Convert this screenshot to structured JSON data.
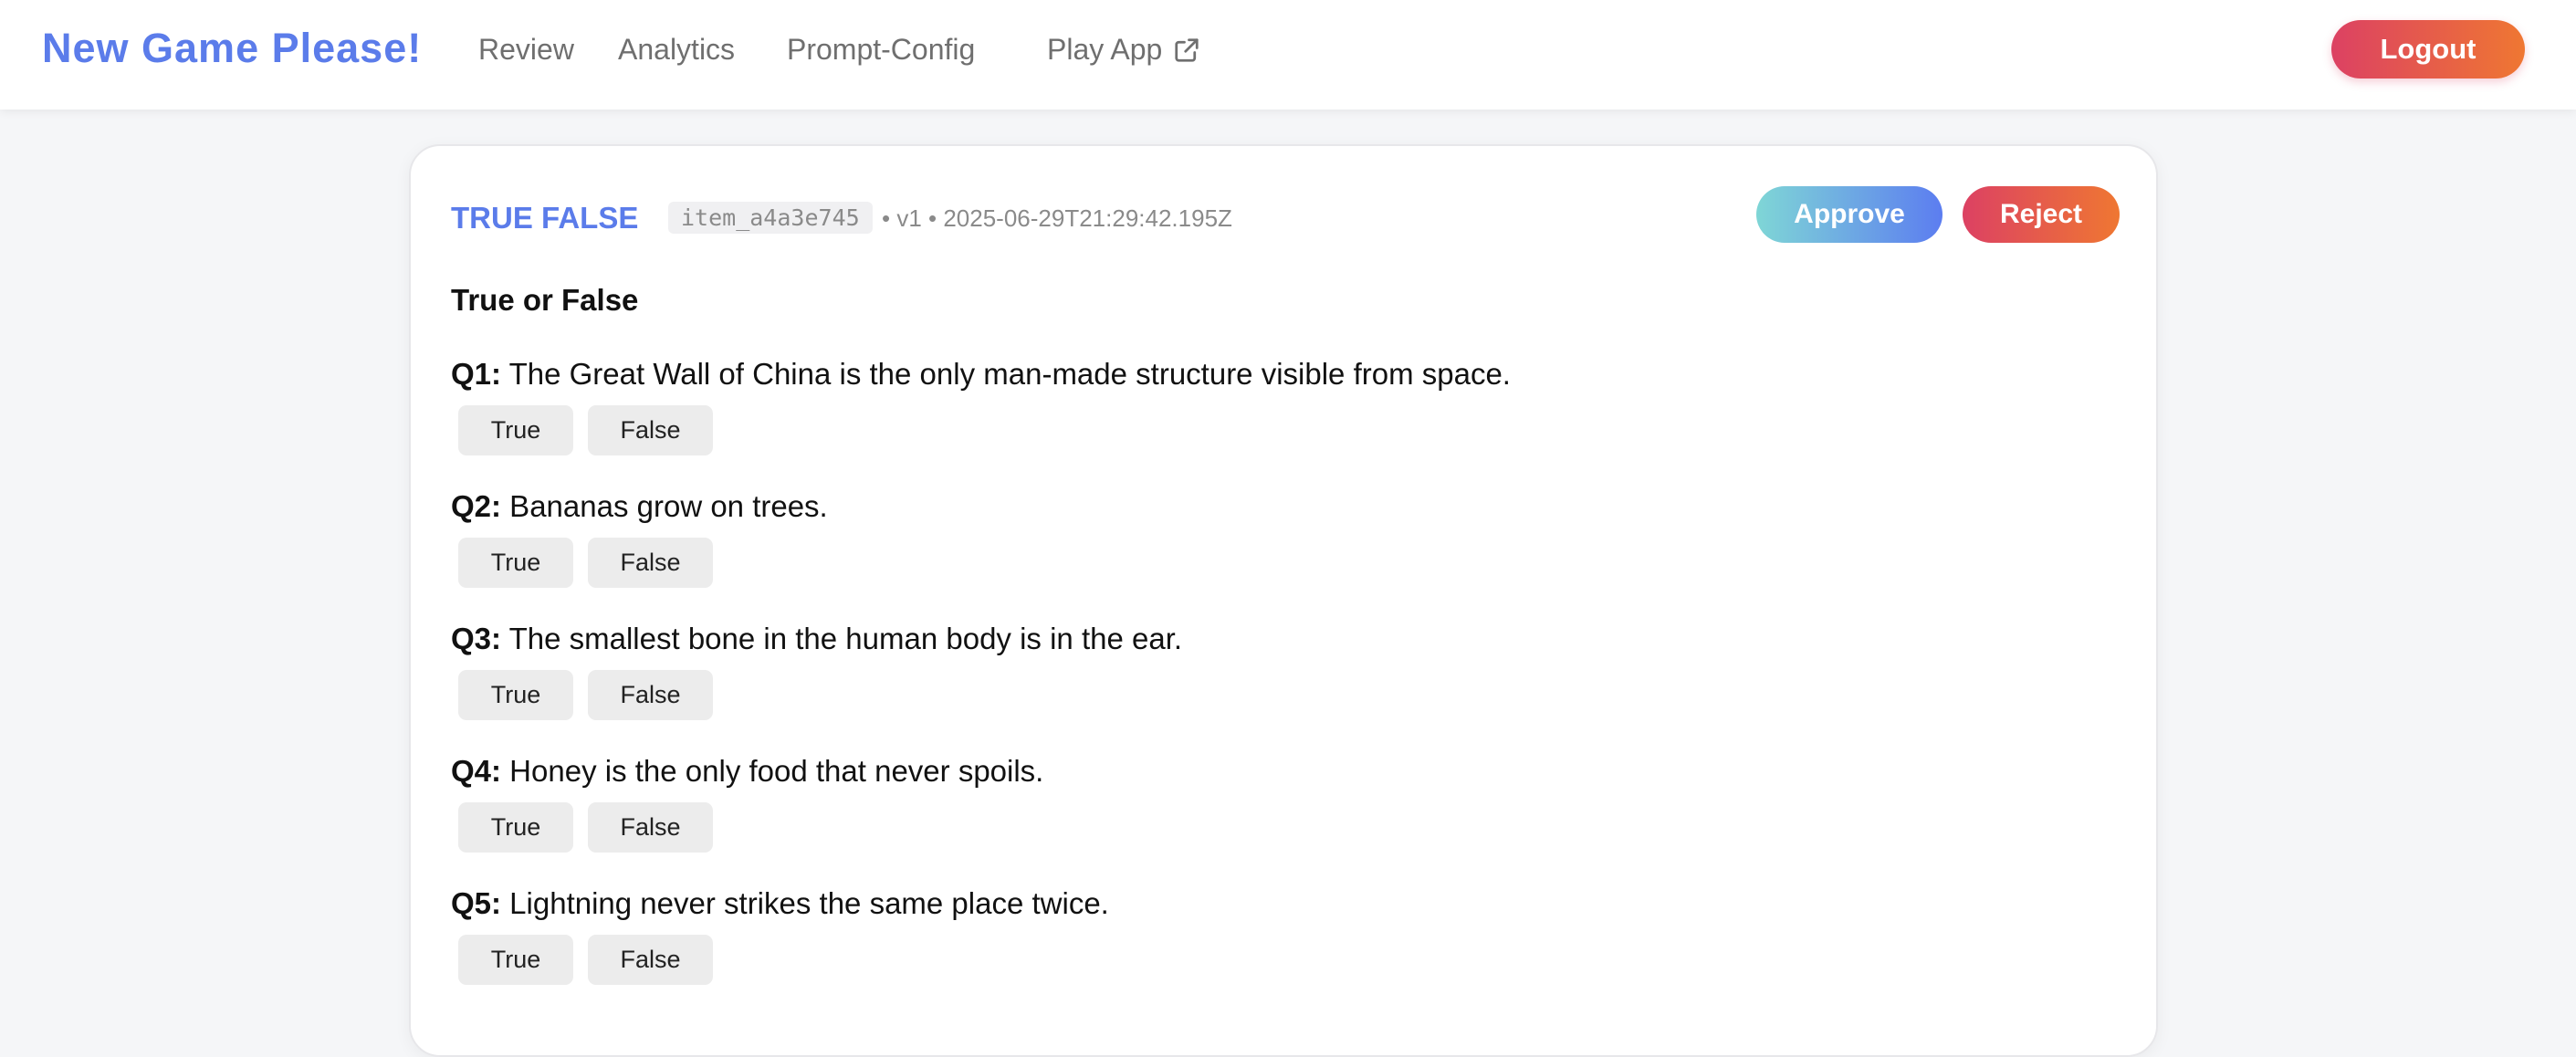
{
  "nav": {
    "brand": "New Game Please!",
    "links": [
      "Review",
      "Analytics",
      "Prompt-Config"
    ],
    "play_app": "Play App",
    "logout": "Logout"
  },
  "item": {
    "type_title": "TRUE FALSE",
    "id": "item_a4a3e745",
    "meta": "• v1 • 2025-06-29T21:29:42.195Z",
    "approve": "Approve",
    "reject": "Reject",
    "heading": "True or False",
    "questions": [
      {
        "num": "Q1:",
        "text": " The Great Wall of China is the only man-made structure visible from space."
      },
      {
        "num": "Q2:",
        "text": " Bananas grow on trees."
      },
      {
        "num": "Q3:",
        "text": " The smallest bone in the human body is in the ear."
      },
      {
        "num": "Q4:",
        "text": " Honey is the only food that never spoils."
      },
      {
        "num": "Q5:",
        "text": " Lightning never strikes the same place twice."
      }
    ],
    "answer_true": "True",
    "answer_false": "False"
  },
  "colors": {
    "brand": "#5b7cea",
    "reject_gradient": [
      "#dc4163",
      "#ef7732"
    ],
    "approve_gradient": [
      "#7fd6d6",
      "#5c7df0"
    ]
  },
  "icons": {
    "play_app": "external-link-icon"
  }
}
